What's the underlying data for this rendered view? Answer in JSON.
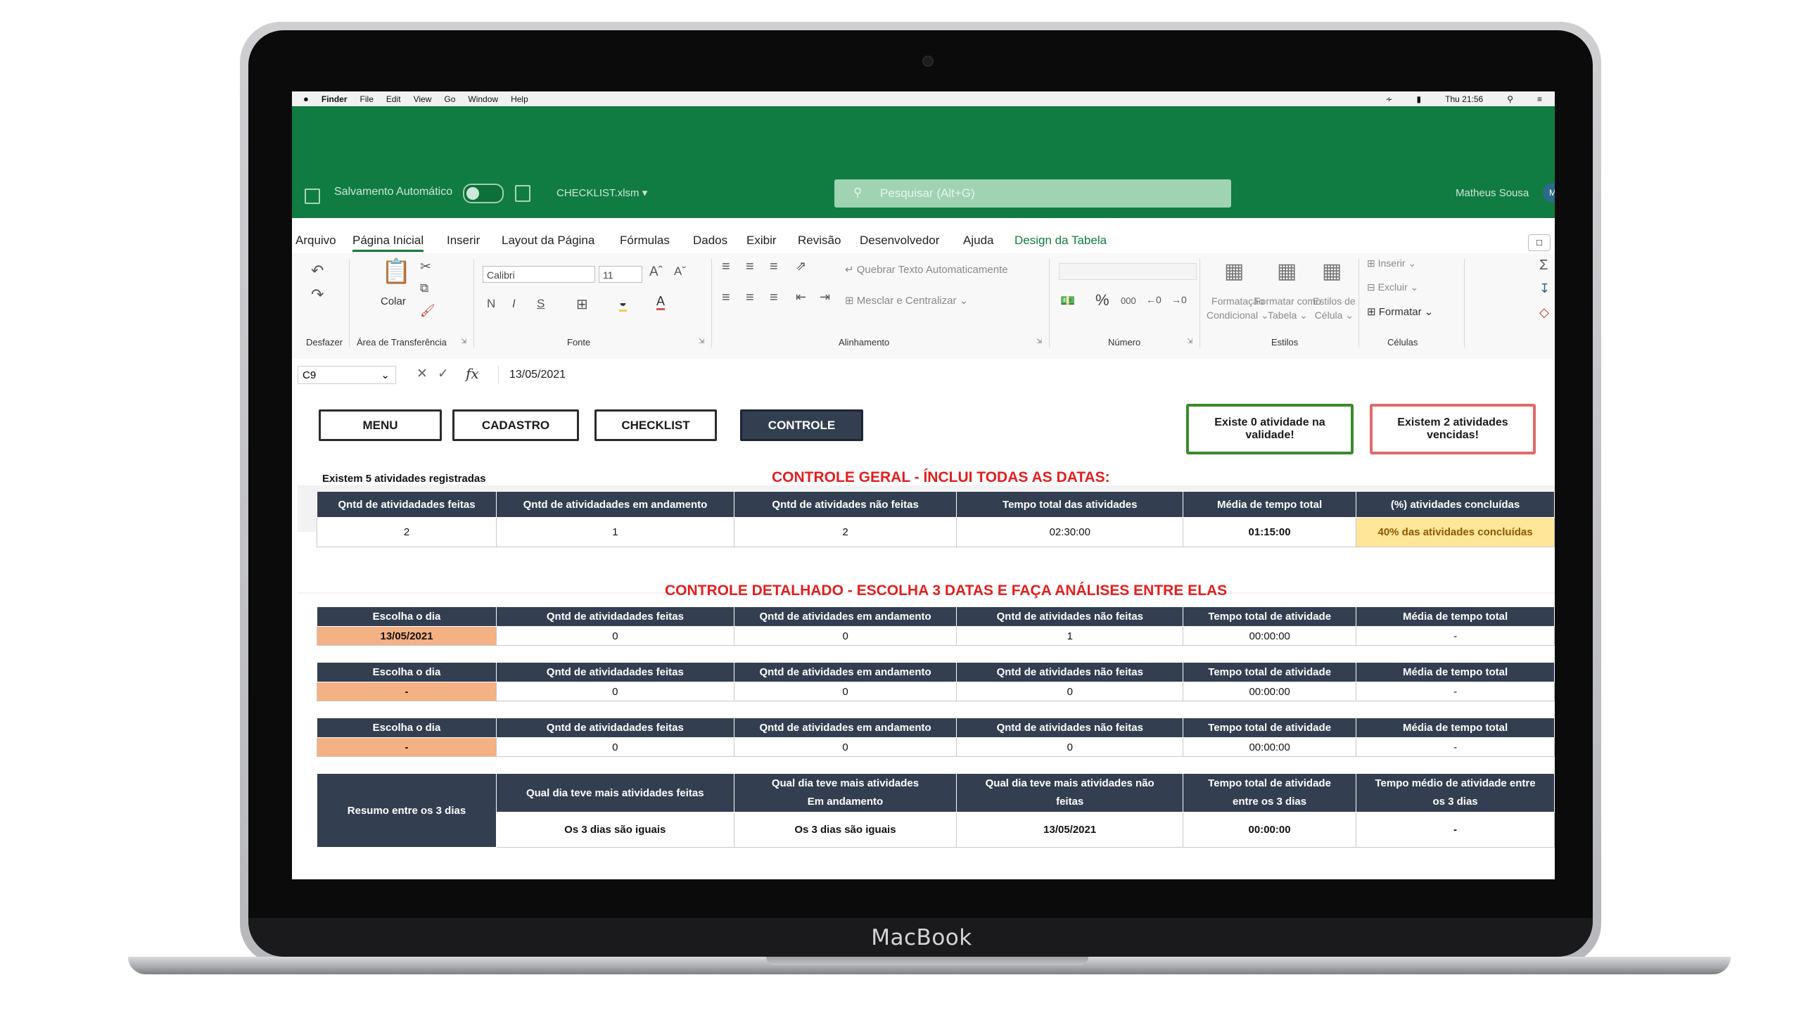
{
  "device": {
    "brand": "MacBook"
  },
  "menubar": {
    "app": "Finder",
    "items": [
      "File",
      "Edit",
      "View",
      "Go",
      "Window",
      "Help"
    ],
    "clock": "Thu 21:56"
  },
  "excel": {
    "autosave_label": "Salvamento Automático",
    "filename": "CHECKLIST.xlsm",
    "search_placeholder": "Pesquisar (Alt+G)",
    "user_name": "Matheus Sousa",
    "user_initial": "M",
    "tabs": [
      "Arquivo",
      "Página Inicial",
      "Inserir",
      "Layout da Página",
      "Fórmulas",
      "Dados",
      "Exibir",
      "Revisão",
      "Desenvolvedor",
      "Ajuda",
      "Design da Tabela"
    ],
    "active_tab": "Página Inicial"
  },
  "ribbon": {
    "undo_label": "Desfazer",
    "paste_label": "Colar",
    "clipboard_label": "Área de Transferência",
    "font_name": "Calibri",
    "font_size": "11",
    "bold": "N",
    "italic": "I",
    "underline": "S",
    "font_label": "Fonte",
    "wrap_text": "Quebrar Texto Automaticamente",
    "merge_center": "Mesclar e Centralizar",
    "alignment_label": "Alinhamento",
    "percent": "%",
    "thousands": "000",
    "number_label": "Número",
    "cond_format_1": "Formatação",
    "cond_format_2": "Condicional",
    "format_table_1": "Formatar como",
    "format_table_2": "Tabela",
    "cell_styles_1": "Estilos de",
    "cell_styles_2": "Célula",
    "styles_label": "Estilos",
    "insert": "Inserir",
    "delete": "Excluir",
    "format": "Formatar",
    "cells_label": "Células"
  },
  "formula_bar": {
    "cell_ref": "C9",
    "fx": "fx",
    "value": "13/05/2021"
  },
  "nav": {
    "menu": "MENU",
    "cadastro": "CADASTRO",
    "checklist": "CHECKLIST",
    "controle": "CONTROLE"
  },
  "alerts": {
    "validity_1": "Existe 0 atividade na",
    "validity_2": "validade!",
    "expired_1": "Existem 2 atividades",
    "expired_2": "vencidas!"
  },
  "registered_text": "Existem 5 atividades registradas",
  "general": {
    "title": "CONTROLE GERAL - ÍNCLUI TODAS AS DATAS:",
    "headers": [
      "Qntd de atividadades feitas",
      "Qntd de atividadades em andamento",
      "Qntd de atividades não feitas",
      "Tempo total das atividades",
      "Média de tempo total",
      "(%) atividades concluídas"
    ],
    "values": [
      "2",
      "1",
      "2",
      "02:30:00",
      "01:15:00",
      "40% das atividades concluídas"
    ]
  },
  "detailed": {
    "title": "CONTROLE DETALHADO - ESCOLHA 3 DATAS E FAÇA ANÁLISES ENTRE ELAS",
    "headers": [
      "Escolha o dia",
      "Qntd de atividadades feitas",
      "Qntd de atividades em andamento",
      "Qntd de atividades não feitas",
      "Tempo total de atividade",
      "Média de tempo total"
    ],
    "rows": [
      [
        "13/05/2021",
        "0",
        "0",
        "1",
        "00:00:00",
        "-"
      ],
      [
        "-",
        "0",
        "0",
        "0",
        "00:00:00",
        "-"
      ],
      [
        "-",
        "0",
        "0",
        "0",
        "00:00:00",
        "-"
      ]
    ]
  },
  "summary": {
    "label": "Resumo entre os 3 dias",
    "headers": [
      [
        "Qual dia teve mais atividades feitas",
        ""
      ],
      [
        "Qual dia teve mais atividades",
        "Em andamento"
      ],
      [
        "Qual dia teve mais atividades não",
        "feitas"
      ],
      [
        "Tempo total de atividade",
        "entre os 3 dias"
      ],
      [
        "Tempo médio de atividade entre",
        "os 3 dias"
      ]
    ],
    "values": [
      "Os 3 dias são iguais",
      "Os 3 dias são iguais",
      "13/05/2021",
      "00:00:00",
      "-"
    ]
  }
}
